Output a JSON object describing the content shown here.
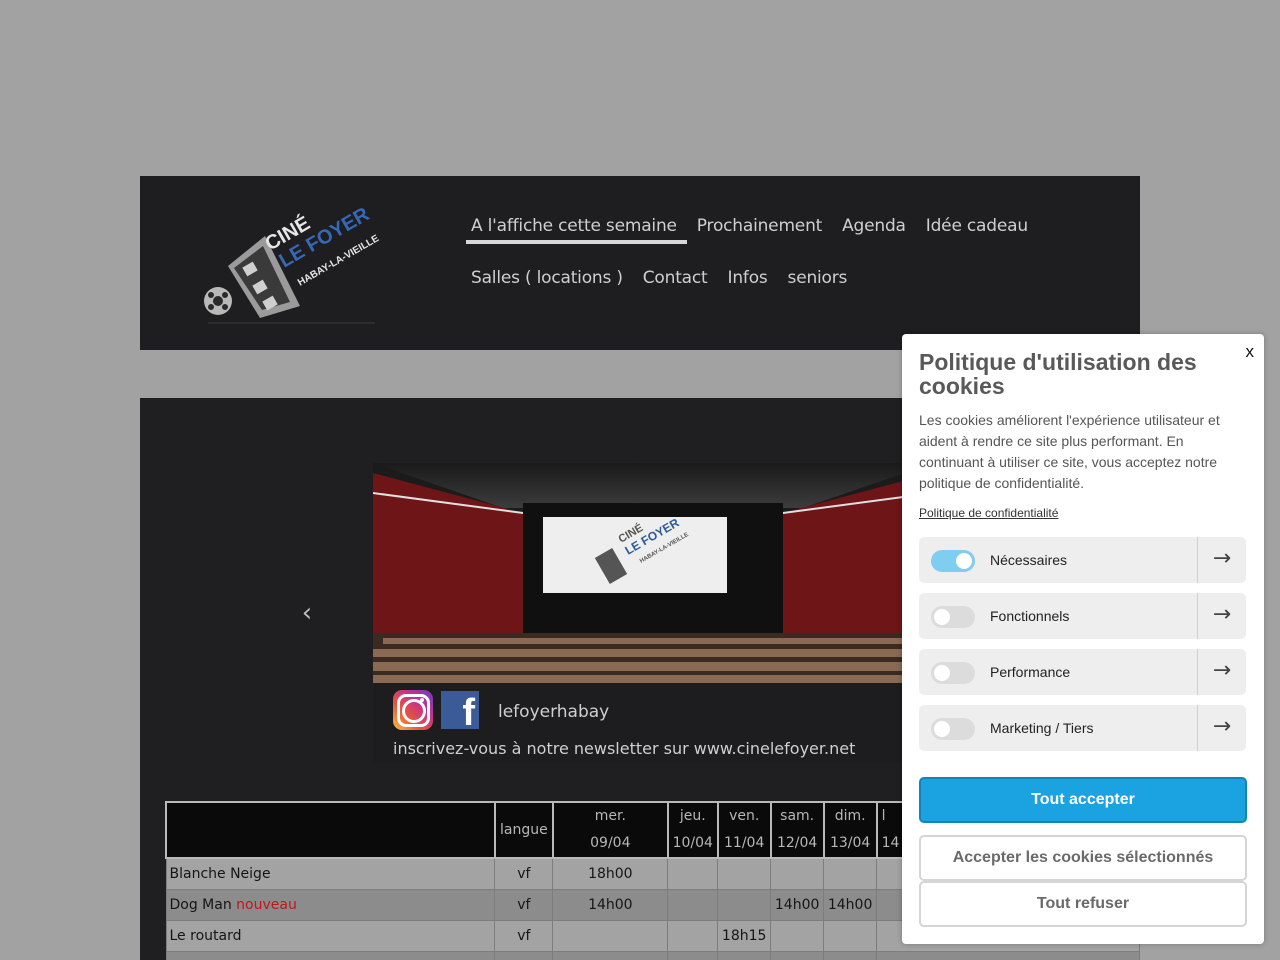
{
  "header": {
    "logo_alt": "CINÉ LE FOYER HABAY-LA-VIEILLE",
    "logo_line1": "CINÉ",
    "logo_line2": "LE FOYER",
    "logo_line3": "HABAY-LA-VIEILLE",
    "nav_row1": [
      "A l'affiche cette semaine",
      "Prochainement",
      "Agenda",
      "Idée cadeau"
    ],
    "nav_row2": [
      "Salles ( locations )",
      "Contact",
      "Infos",
      "seniors"
    ]
  },
  "slider": {
    "screen_logo_line1": "CINÉ",
    "screen_logo_line2": "LE FOYER",
    "screen_logo_line3": "HABAY-LA-VIEILLE",
    "social_handle": "lefoyerhabay",
    "newsletter": "inscrivez-vous à notre newsletter sur www.cinelefoyer.net",
    "prev_glyph": "‹"
  },
  "schedule": {
    "headers": [
      {
        "line1": "",
        "line2": ""
      },
      {
        "line1": "langue",
        "line2": ""
      },
      {
        "line1": "mer.",
        "line2": "09/04"
      },
      {
        "line1": "jeu.",
        "line2": "10/04"
      },
      {
        "line1": "ven.",
        "line2": "11/04"
      },
      {
        "line1": "sam.",
        "line2": "12/04"
      },
      {
        "line1": "dim.",
        "line2": "13/04"
      },
      {
        "line1": "l",
        "line2": "14"
      }
    ],
    "rows": [
      {
        "title": "Blanche Neige",
        "tag": "",
        "lang": "vf",
        "times": [
          "18h00",
          "",
          "",
          "",
          "",
          ""
        ]
      },
      {
        "title": "Dog Man",
        "tag": "nouveau",
        "lang": "vf",
        "times": [
          "14h00",
          "",
          "",
          "14h00",
          "14h00",
          ""
        ]
      },
      {
        "title": "Le routard",
        "tag": "",
        "lang": "vf",
        "times": [
          "",
          "",
          "18h15",
          "",
          "",
          ""
        ]
      }
    ]
  },
  "cookie": {
    "close": "x",
    "title": "Politique d'utilisation des cookies",
    "text": "Les cookies améliorent l'expérience utilisateur et aident à rendre ce site plus performant. En continuant à utiliser ce site, vous acceptez notre politique de confidentialité.",
    "policy_link": "Politique de confidentialité",
    "categories": [
      {
        "label": "Nécessaires",
        "enabled": true
      },
      {
        "label": "Fonctionnels",
        "enabled": false
      },
      {
        "label": "Performance",
        "enabled": false
      },
      {
        "label": "Marketing / Tiers",
        "enabled": false
      }
    ],
    "arrow_glyph": "→",
    "accept_all": "Tout accepter",
    "accept_selected": "Accepter les cookies sélectionnés",
    "refuse_all": "Tout refuser"
  },
  "colors": {
    "page_bg": "#a2a2a2",
    "header_bg": "#1e1d1f",
    "accept_blue": "#1aa3e0",
    "toggle_on": "#7fcdf1",
    "new_tag": "#c0161c"
  }
}
